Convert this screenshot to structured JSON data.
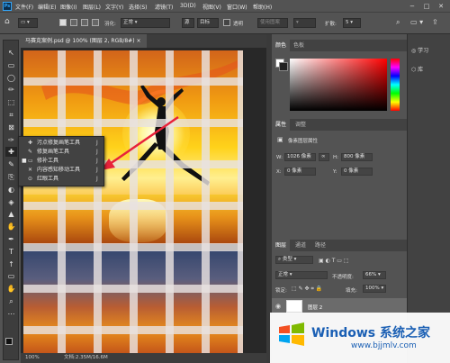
{
  "app": {
    "logo": "Ps"
  },
  "menu": [
    "文件(F)",
    "编辑(E)",
    "图像(I)",
    "图层(L)",
    "文字(Y)",
    "选择(S)",
    "滤镜(T)",
    "3D(D)",
    "视图(V)",
    "窗口(W)",
    "帮助(H)"
  ],
  "window_controls": {
    "minimize": "−",
    "maximize": "□",
    "close": "✕"
  },
  "options": {
    "feather_label": "羽化:",
    "mode_label": "正常",
    "btn_source": "源",
    "btn_target": "目标",
    "transparent": "透明",
    "pattern_btn": "使用图案",
    "spread_label": "扩散:",
    "spread_value": "5"
  },
  "document": {
    "tab_title": "马赛克案例.psd @ 100% (图层 2, RGB/8#)",
    "tab_close": "×",
    "zoom": "100%",
    "doc_size": "文档:2.35M/16.6M"
  },
  "flyout": {
    "items": [
      {
        "icon": "✚",
        "label": "污点修复画笔工具",
        "key": "J",
        "active": false
      },
      {
        "icon": "✎",
        "label": "修复画笔工具",
        "key": "J",
        "active": false
      },
      {
        "icon": "▭",
        "label": "修补工具",
        "key": "J",
        "active": true
      },
      {
        "icon": "✕",
        "label": "内容感知移动工具",
        "key": "J",
        "active": false
      },
      {
        "icon": "⊙",
        "label": "红眼工具",
        "key": "J",
        "active": false
      }
    ],
    "active_marker": "■"
  },
  "tools": [
    "↖",
    "▭",
    "◯",
    "✏",
    "⬚",
    "⌗",
    "⊠",
    "✑",
    "✚",
    "✎",
    "⎘",
    "◐",
    "◈",
    "▲",
    "✋",
    "✒",
    "T",
    "↑",
    "▭",
    "✋",
    "⌕",
    "⋯"
  ],
  "color_panel": {
    "tabs": [
      "颜色",
      "色板"
    ]
  },
  "properties_panel": {
    "tabs": [
      "属性",
      "调整"
    ],
    "layer_type": "像素图层属性",
    "W_label": "W:",
    "W": "1026 像素",
    "link": "∞",
    "H_label": "H:",
    "H": "800 像素",
    "X_label": "X:",
    "X": "0 像素",
    "Y_label": "Y:",
    "Y": "0 像素"
  },
  "layers_panel": {
    "tabs": [
      "图层",
      "通道",
      "路径"
    ],
    "filter": "类型",
    "blend": "正常",
    "opacity_label": "不透明度:",
    "opacity": "66%",
    "lock_label": "锁定:",
    "fill_label": "填充:",
    "fill": "100%",
    "layer_name": "图层 2"
  },
  "right_panel": {
    "items": [
      {
        "icon": "◎",
        "label": "学习"
      },
      {
        "icon": "⬡",
        "label": "库"
      }
    ]
  },
  "watermark": {
    "title": "Windows 系统之家",
    "url": "www.bjjmlv.com"
  },
  "colors": {
    "accent": "#31a8ff",
    "arrow": "#e8223a",
    "bg": "#535353"
  }
}
